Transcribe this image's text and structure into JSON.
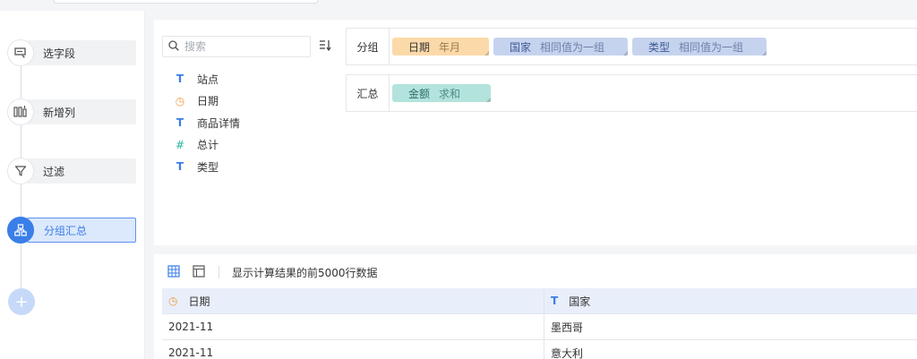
{
  "steps": [
    {
      "label": "选字段",
      "icon": "select-field-icon"
    },
    {
      "label": "新增列",
      "icon": "add-column-icon"
    },
    {
      "label": "过滤",
      "icon": "filter-icon"
    },
    {
      "label": "分组汇总",
      "icon": "group-summary-icon",
      "active": true
    }
  ],
  "add_step_symbol": "+",
  "search": {
    "placeholder": "搜索"
  },
  "fields": [
    {
      "name": "站点",
      "type": "text",
      "symbol": "T"
    },
    {
      "name": "日期",
      "type": "date",
      "symbol": "◷"
    },
    {
      "name": "商品详情",
      "type": "text",
      "symbol": "T"
    },
    {
      "name": "总计",
      "type": "number",
      "symbol": "#"
    },
    {
      "name": "类型",
      "type": "text",
      "symbol": "T"
    }
  ],
  "group_zone": {
    "label": "分组",
    "tags": [
      {
        "name": "日期",
        "agg": "年月"
      },
      {
        "name": "国家",
        "agg": "相同值为一组"
      },
      {
        "name": "类型",
        "agg": "相同值为一组"
      }
    ]
  },
  "summary_zone": {
    "label": "汇总",
    "tags": [
      {
        "name": "金额",
        "agg": "求和"
      }
    ]
  },
  "result": {
    "hint": "显示计算结果的前5000行数据",
    "columns": [
      {
        "name": "日期",
        "symbol": "◷"
      },
      {
        "name": "国家",
        "symbol": "T"
      }
    ],
    "rows": [
      [
        "2021-11",
        "墨西哥"
      ],
      [
        "2021-11",
        "意大利"
      ]
    ]
  },
  "colors": {
    "accent": "#3a7ee8",
    "date_tag": "#fcd9a8",
    "dim_tag": "#c6d3ef",
    "num_tag": "#b3e3dd"
  }
}
